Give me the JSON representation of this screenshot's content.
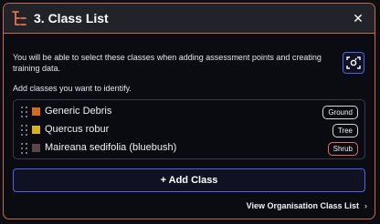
{
  "header": {
    "title": "3. Class List",
    "close_icon": "close-icon",
    "icon": "class-list-icon"
  },
  "intro": {
    "text": "You will be able to select these classes when adding assessment points and creating training data.",
    "camera_icon": "camera-capture-icon"
  },
  "prompt": "Add classes you want to identify.",
  "classes": [
    {
      "name": "Generic Debris",
      "color": "#d2691e",
      "tag": "Ground",
      "tag_border": "#d8d8d8"
    },
    {
      "name": "Quercus robur",
      "color": "#d4b418",
      "tag": "Tree",
      "tag_border": "#d8d8d8"
    },
    {
      "name": "Maireana sedifolia (bluebush)",
      "color": "#5a4548",
      "tag": "Shrub",
      "tag_border": "#e06b6b"
    }
  ],
  "add_button": "+ Add Class",
  "org_link": "View Organisation Class List",
  "colors": {
    "accent_border": "#c96a3f",
    "button_border": "#5a60e6"
  }
}
